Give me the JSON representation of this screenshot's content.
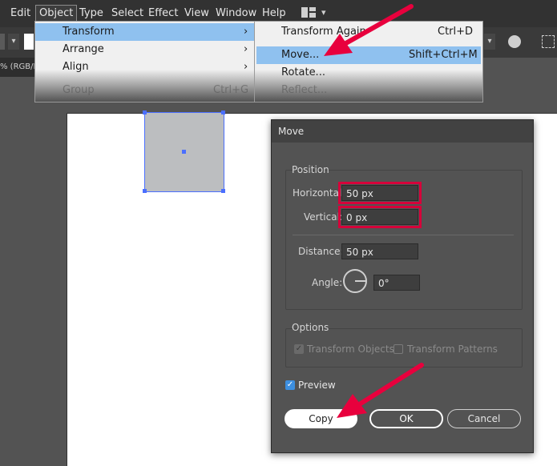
{
  "menubar": {
    "items": [
      "Edit",
      "Object",
      "Type",
      "Select",
      "Effect",
      "View",
      "Window",
      "Help"
    ]
  },
  "document_tab": "% (RGB/Preview)",
  "object_menu": {
    "items": [
      {
        "label": "Transform",
        "arrow": "›",
        "highlighted": true
      },
      {
        "label": "Arrange",
        "arrow": "›"
      },
      {
        "label": "Align",
        "arrow": "›"
      },
      {
        "label": "Group",
        "shortcut": "Ctrl+G"
      }
    ]
  },
  "transform_submenu": {
    "items": [
      {
        "label": "Transform Again",
        "shortcut": "Ctrl+D"
      },
      {
        "label": "Move...",
        "shortcut": "Shift+Ctrl+M",
        "highlighted": true
      },
      {
        "label": "Rotate...",
        "shortcut": ""
      },
      {
        "label": "Reflect...",
        "shortcut": ""
      }
    ]
  },
  "move_dialog": {
    "title": "Move",
    "position_label": "Position",
    "horizontal_label": "Horizontal:",
    "horizontal_value": "50 px",
    "vertical_label": "Vertical:",
    "vertical_value": "0 px",
    "distance_label": "Distance:",
    "distance_value": "50 px",
    "angle_label": "Angle:",
    "angle_value": "0°",
    "options_label": "Options",
    "transform_objects_label": "Transform Objects",
    "transform_objects_checked": true,
    "transform_patterns_label": "Transform Patterns",
    "transform_patterns_checked": false,
    "preview_label": "Preview",
    "preview_checked": true,
    "copy_label": "Copy",
    "ok_label": "OK",
    "cancel_label": "Cancel"
  },
  "colors": {
    "highlight": "#8fc1ef",
    "callout": "#e8003d",
    "selection": "#4b6fff",
    "check_accent": "#3d8fe0"
  }
}
